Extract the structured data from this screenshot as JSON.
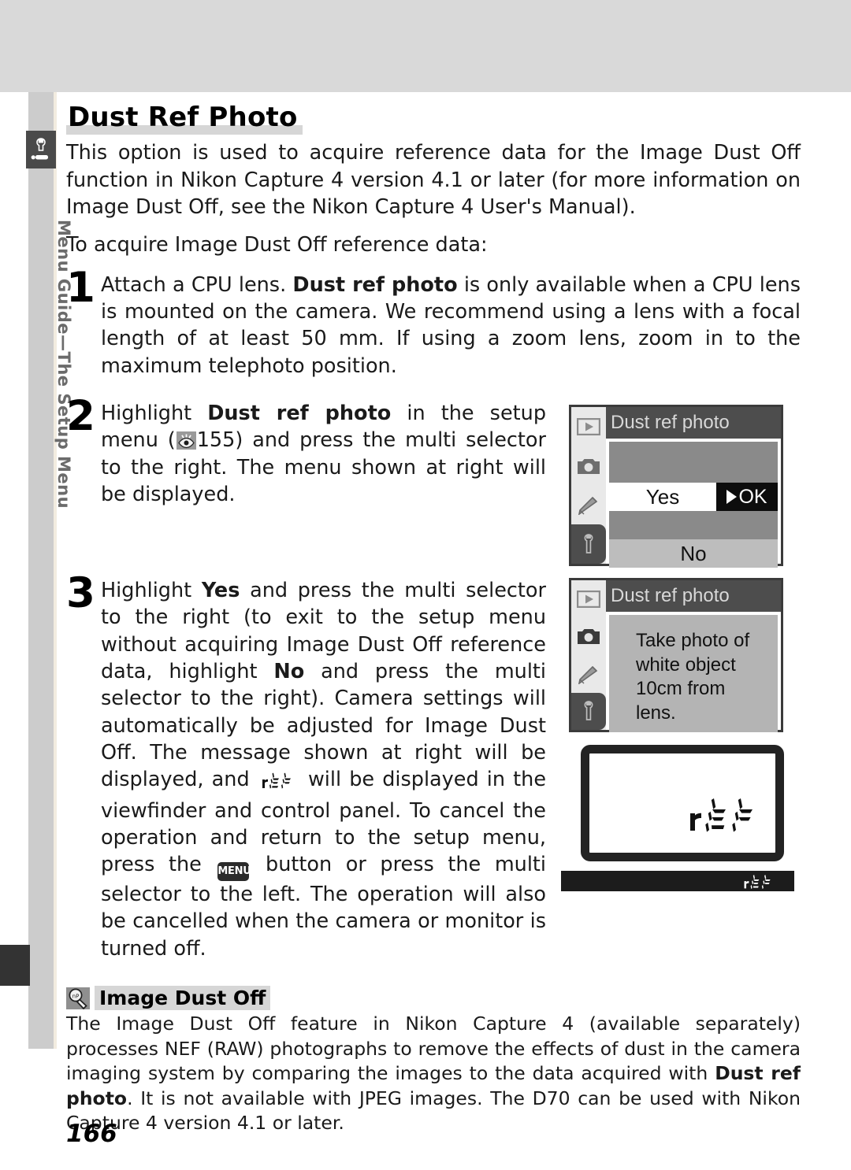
{
  "sidebar": {
    "tab_label": "Menu Guide—The Setup Menu",
    "tab_icon": "wrench-setup-icon"
  },
  "page": {
    "title": "Dust Ref Photo",
    "number": "166"
  },
  "intro": {
    "paragraph_1_before": "This option is used to acquire reference data for the Image Dust Off function in Nikon Capture 4 version 4.1 or later (for more information on Image Dust Off, see the ",
    "paragraph_1_italic": "Nikon Capture 4 User's Manual",
    "paragraph_1_after": ").",
    "paragraph_2": "To acquire Image Dust Off reference data:"
  },
  "steps": [
    {
      "number": "1",
      "text_1": "Attach a CPU lens.  ",
      "bold_1": "Dust ref photo",
      "text_2": " is only available when a CPU lens is mounted on the camera.  We recommend using a lens with a focal length of at least 50 mm.  If using a zoom lens, zoom in to the maximum telephoto position."
    },
    {
      "number": "2",
      "text_1": "Highlight ",
      "bold_1": "Dust ref photo",
      "text_2": " in the setup menu (",
      "page_ref": "155",
      "text_3": ") and press the multi selector to the right.  The menu shown at right will be displayed."
    },
    {
      "number": "3",
      "text_1": "Highlight ",
      "bold_1": "Yes",
      "text_2": " and press the multi selector to the right (to exit to the setup menu without acquiring Image Dust Off reference data, highlight ",
      "bold_2": "No",
      "text_3": " and press the multi selector to the right).  Camera settings will automatically be adjusted for Image Dust Off.  The message shown at right will be displayed, and ",
      "seg_1": "rEF",
      "text_4": " will be displayed in the viewfinder and control panel.  To cancel the operation and return to the setup menu, press the ",
      "menu_button": "MENU",
      "text_5": " button or press the multi selector to the left.  The operation will also be cancelled when the camera or monitor is turned off."
    }
  ],
  "lcd_menu": {
    "title": "Dust ref photo",
    "rail_icons": [
      "playback-icon",
      "camera-icon",
      "pencil-icon",
      "wrench-icon"
    ],
    "selected_rail_icon": "wrench-icon",
    "option_yes": "Yes",
    "option_no": "No",
    "ok_label": "OK"
  },
  "lcd_message": {
    "title": "Dust ref photo",
    "rail_icons": [
      "playback-icon",
      "camera-icon",
      "pencil-icon",
      "wrench-icon"
    ],
    "selected_rail_icon": "wrench-icon",
    "message": "Take photo of white object 10cm from lens."
  },
  "viewfinder": {
    "segment_text": "rEF"
  },
  "control_panel": {
    "segment_text": "rEF"
  },
  "note": {
    "icon": "lightbulb-tip-icon",
    "title": "Image Dust Off",
    "text_1": "The Image Dust Off feature in Nikon Capture 4 (available separately) processes NEF (RAW) photographs to remove the effects of dust in the camera imaging system by comparing the images to the data acquired with ",
    "bold_1": "Dust ref photo",
    "text_2": ".  It is not available with JPEG images.  The D70 can be used with Nikon Capture 4 version 4.1 or later."
  },
  "colors": {
    "band": "#d9d9d9",
    "rail": "#cccccc",
    "lcd_header": "#4d4d4d",
    "lcd_body": "#8a8a8a",
    "highlight": "#d6d6d6"
  }
}
